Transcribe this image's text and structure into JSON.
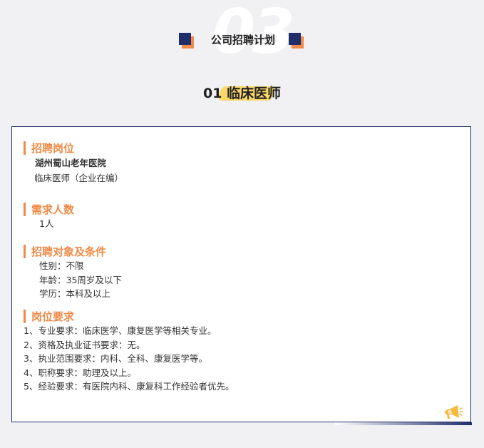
{
  "header": {
    "big_number": "03",
    "section_title": "公司招聘计划",
    "job_title": "01 临床医师"
  },
  "sections": {
    "position": {
      "label": "招聘岗位",
      "hospital": "湖州蜀山老年医院",
      "role": "临床医师（企业在编）"
    },
    "headcount": {
      "label": "需求人数",
      "value": "1人"
    },
    "conditions": {
      "label": "招聘对象及条件",
      "lines": [
        "性别：不限",
        "年龄：35周岁及以下",
        "学历：本科及以上"
      ]
    },
    "requirements": {
      "label": "岗位要求",
      "lines": [
        "1、专业要求：临床医学、康复医学等相关专业。",
        "2、资格及执业证书要求：无。",
        "3、执业范围要求：内科、全科、康复医学等。",
        "4、职称要求：助理及以上。",
        "5、经验要求：有医院内科、康复科工作经验者优先。"
      ]
    }
  },
  "colors": {
    "accent": "#f08a46",
    "navy": "#1f2d6b",
    "highlight": "#fbd669",
    "background": "#f1f1f3"
  },
  "icons": {
    "corner": "megaphone-icon"
  }
}
